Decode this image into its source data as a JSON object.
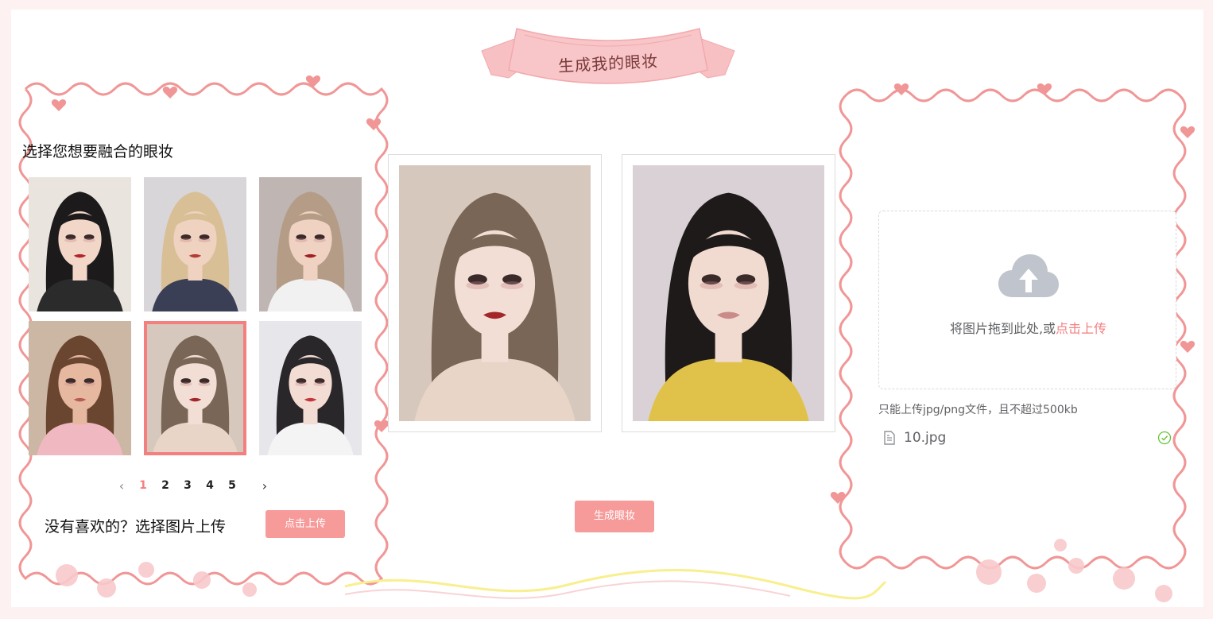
{
  "banner": {
    "title": "生成我的眼妆"
  },
  "left_panel": {
    "title": "选择您想要融合的眼妆",
    "thumbnails": [
      {
        "name": "makeup-thumb-1",
        "selected": false,
        "bg": "#e9e4de",
        "hair": "#1d1a1c",
        "skin": "#f2d7c9",
        "lip": "#b2252a",
        "top": "#2b2b2b"
      },
      {
        "name": "makeup-thumb-2",
        "selected": false,
        "bg": "#d9d6d9",
        "hair": "#d9bf96",
        "skin": "#f0d2c0",
        "lip": "#b63a3a",
        "top": "#3a3f56"
      },
      {
        "name": "makeup-thumb-3",
        "selected": false,
        "bg": "#bfb5b2",
        "hair": "#b59c86",
        "skin": "#efd2c2",
        "lip": "#9e1f24",
        "top": "#f1f1f1"
      },
      {
        "name": "makeup-thumb-4",
        "selected": false,
        "bg": "#cbb7a3",
        "hair": "#6a4530",
        "skin": "#e6b8a0",
        "lip": "#b85a55",
        "top": "#f0b8c0"
      },
      {
        "name": "makeup-thumb-5",
        "selected": true,
        "bg": "#d6c8bd",
        "hair": "#7a6656",
        "skin": "#f2ded5",
        "lip": "#a3262a",
        "top": "#e8d5c8"
      },
      {
        "name": "makeup-thumb-6",
        "selected": false,
        "bg": "#e7e6ea",
        "hair": "#2a272b",
        "skin": "#f3dcd3",
        "lip": "#c4383d",
        "top": "#f4f4f4"
      }
    ],
    "pagination": {
      "prev": "‹",
      "next": "›",
      "pages": [
        "1",
        "2",
        "3",
        "4",
        "5"
      ],
      "active": "1"
    },
    "no_like_text": "没有喜欢的？选择图片上传",
    "upload_button": "点击上传"
  },
  "middle": {
    "selected_makeup": {
      "bg": "#d6c8bd",
      "hair": "#7a6656",
      "skin": "#f2ded5",
      "lip": "#a3262a",
      "top": "#e8d5c8"
    },
    "user_photo": {
      "bg": "#d9d1d6",
      "hair": "#1f1a1a",
      "skin": "#f1dbd0",
      "lip": "#c98b88",
      "top": "#e0c24a"
    },
    "generate_button": "生成眼妆"
  },
  "right_panel": {
    "drop_text": "将图片拖到此处,或",
    "drop_link": "点击上传",
    "tip": "只能上传jpg/png文件，且不超过500kb",
    "file_name": "10.jpg",
    "file_status_icon": "check-circle-icon"
  },
  "colors": {
    "accent": "#f79a9a",
    "active": "#f37f7f",
    "frame": "#f19696",
    "success": "#67c23a"
  }
}
